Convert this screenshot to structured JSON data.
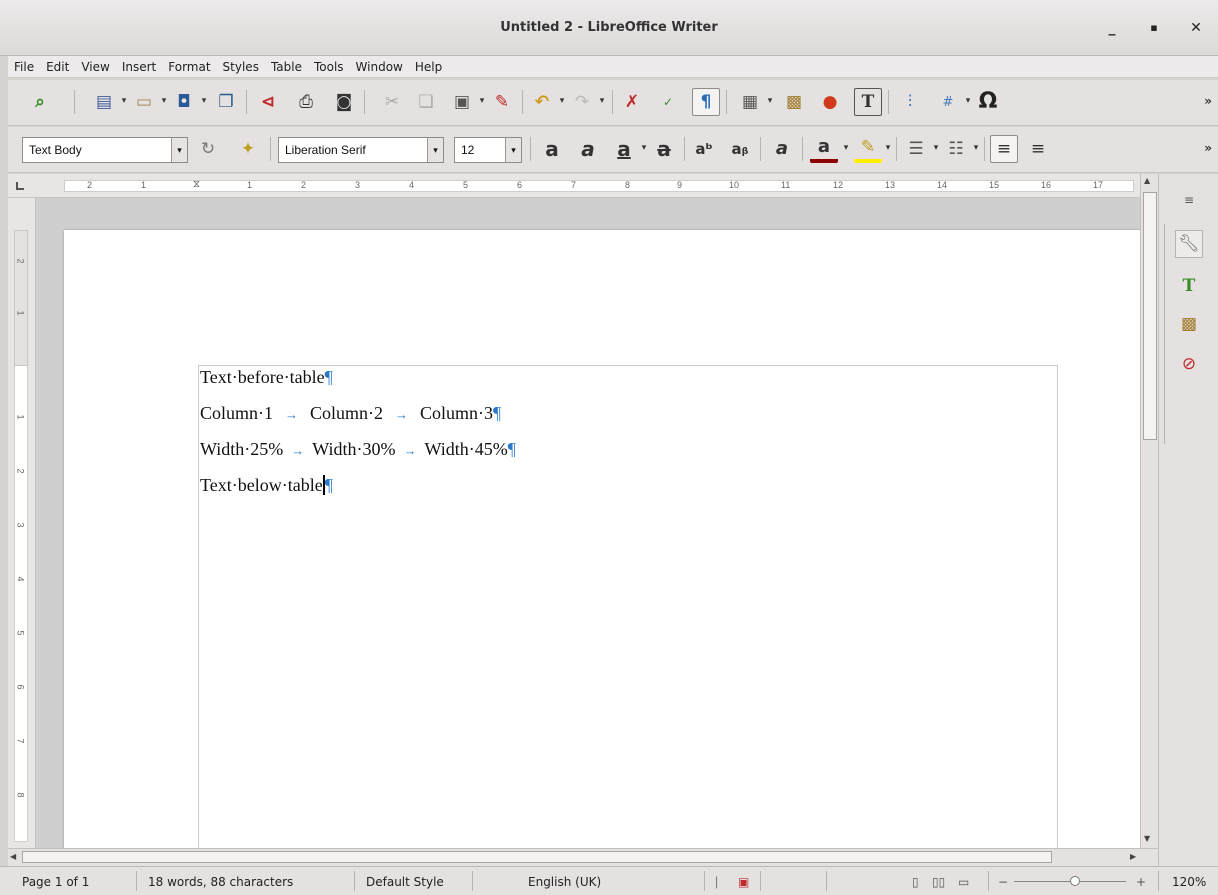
{
  "window": {
    "title": "Untitled 2 - LibreOffice Writer",
    "minimize": "_",
    "maximize": "▪",
    "close": "✕"
  },
  "menu": [
    "File",
    "Edit",
    "View",
    "Insert",
    "Format",
    "Styles",
    "Table",
    "Tools",
    "Window",
    "Help"
  ],
  "formatting": {
    "paragraph_style": "Text Body",
    "font_name": "Liberation Serif",
    "font_size": "12"
  },
  "ruler": {
    "h_numbers": [
      "2",
      "1",
      "1",
      "2",
      "3",
      "4",
      "5",
      "6",
      "7",
      "8",
      "9",
      "10",
      "11",
      "12",
      "13",
      "14",
      "15",
      "16",
      "17"
    ],
    "v_numbers": [
      "2",
      "1",
      "1",
      "2",
      "3",
      "4",
      "5",
      "6",
      "7",
      "8"
    ]
  },
  "document": {
    "lines": [
      {
        "text": "Text·before·table",
        "mark": "¶"
      },
      {
        "c1": "Column·1",
        "c2": "Column·2",
        "c3": "Column·3",
        "mark": "¶"
      },
      {
        "c1": "Width·25%",
        "c2": "Width·30%",
        "c3": "Width·45%",
        "mark": "¶"
      },
      {
        "text": "Text·below·table",
        "mark": "¶"
      }
    ],
    "tab_arrow": "→"
  },
  "status": {
    "page": "Page 1 of 1",
    "words": "18 words, 88 characters",
    "page_style": "Default Style",
    "language": "English (UK)",
    "zoom": "120%"
  },
  "colors": {
    "accent": "#2a79c9",
    "font_color_bar": "#8b0000",
    "highlight_bar": "#ffee00"
  }
}
